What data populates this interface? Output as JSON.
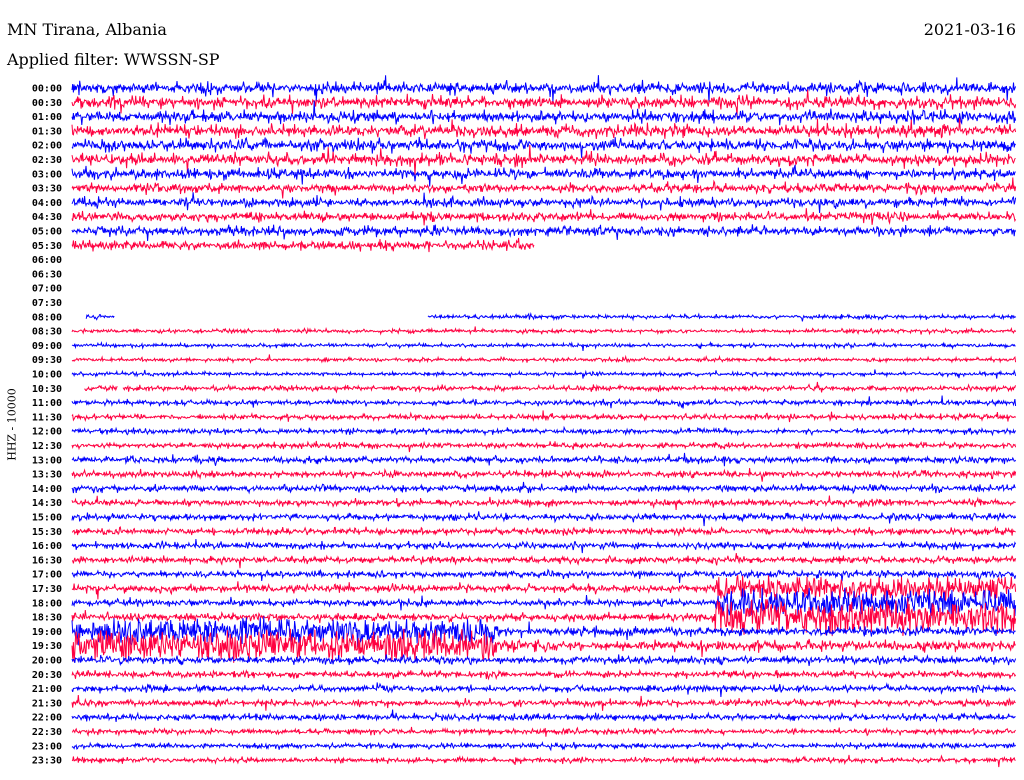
{
  "header": {
    "station": "MN Tirana, Albania",
    "date": "2021-03-16",
    "filter": "Applied filter: WWSSN-SP"
  },
  "chart_data": {
    "type": "line",
    "title": "MN Tirana, Albania",
    "ylabel": "HHZ - 10000",
    "colors": [
      "#0000ff",
      "#ff0040"
    ],
    "x_unit": "fraction of 30 min row",
    "rows": [
      {
        "label": "00:00",
        "segments": [
          [
            0,
            1
          ]
        ],
        "amp": 9
      },
      {
        "label": "00:30",
        "segments": [
          [
            0,
            1
          ]
        ],
        "amp": 9
      },
      {
        "label": "01:00",
        "segments": [
          [
            0,
            1
          ]
        ],
        "amp": 9
      },
      {
        "label": "01:30",
        "segments": [
          [
            0,
            1
          ]
        ],
        "amp": 9
      },
      {
        "label": "02:00",
        "segments": [
          [
            0,
            1
          ]
        ],
        "amp": 9
      },
      {
        "label": "02:30",
        "segments": [
          [
            0,
            1
          ]
        ],
        "amp": 9
      },
      {
        "label": "03:00",
        "segments": [
          [
            0,
            1
          ]
        ],
        "amp": 8
      },
      {
        "label": "03:30",
        "segments": [
          [
            0,
            1
          ]
        ],
        "amp": 7
      },
      {
        "label": "04:00",
        "segments": [
          [
            0,
            1
          ]
        ],
        "amp": 7
      },
      {
        "label": "04:30",
        "segments": [
          [
            0,
            1
          ]
        ],
        "amp": 7
      },
      {
        "label": "05:00",
        "segments": [
          [
            0,
            1
          ]
        ],
        "amp": 7
      },
      {
        "label": "05:30",
        "segments": [
          [
            0,
            0.49
          ]
        ],
        "amp": 7
      },
      {
        "label": "06:00",
        "segments": [],
        "amp": 0
      },
      {
        "label": "06:30",
        "segments": [],
        "amp": 0
      },
      {
        "label": "07:00",
        "segments": [],
        "amp": 0
      },
      {
        "label": "07:30",
        "segments": [],
        "amp": 0
      },
      {
        "label": "08:00",
        "segments": [
          [
            0.015,
            0.045
          ],
          [
            0.377,
            1
          ]
        ],
        "amp": 3
      },
      {
        "label": "08:30",
        "segments": [
          [
            0,
            1
          ]
        ],
        "amp": 3
      },
      {
        "label": "09:00",
        "segments": [
          [
            0,
            1
          ]
        ],
        "amp": 3
      },
      {
        "label": "09:30",
        "segments": [
          [
            0,
            1
          ]
        ],
        "amp": 3
      },
      {
        "label": "10:00",
        "segments": [
          [
            0,
            1
          ]
        ],
        "amp": 3
      },
      {
        "label": "10:30",
        "segments": [
          [
            0.013,
            0.048
          ],
          [
            0.054,
            1
          ]
        ],
        "amp": 4
      },
      {
        "label": "11:00",
        "segments": [
          [
            0,
            1
          ]
        ],
        "amp": 4
      },
      {
        "label": "11:30",
        "segments": [
          [
            0,
            1
          ]
        ],
        "amp": 4
      },
      {
        "label": "12:00",
        "segments": [
          [
            0,
            1
          ]
        ],
        "amp": 4
      },
      {
        "label": "12:30",
        "segments": [
          [
            0,
            1
          ]
        ],
        "amp": 4
      },
      {
        "label": "13:00",
        "segments": [
          [
            0,
            1
          ]
        ],
        "amp": 5
      },
      {
        "label": "13:30",
        "segments": [
          [
            0,
            1
          ]
        ],
        "amp": 5
      },
      {
        "label": "14:00",
        "segments": [
          [
            0,
            1
          ]
        ],
        "amp": 5
      },
      {
        "label": "14:30",
        "segments": [
          [
            0,
            1
          ]
        ],
        "amp": 5
      },
      {
        "label": "15:00",
        "segments": [
          [
            0,
            1
          ]
        ],
        "amp": 5
      },
      {
        "label": "15:30",
        "segments": [
          [
            0,
            1
          ]
        ],
        "amp": 5
      },
      {
        "label": "16:00",
        "segments": [
          [
            0,
            1
          ]
        ],
        "amp": 5
      },
      {
        "label": "16:30",
        "segments": [
          [
            0,
            1
          ]
        ],
        "amp": 5
      },
      {
        "label": "17:00",
        "segments": [
          [
            0,
            1
          ]
        ],
        "amp": 5
      },
      {
        "label": "17:30",
        "segments": [
          [
            0,
            1
          ]
        ],
        "amp": 6,
        "event": [
          0.68,
          1,
          14
        ]
      },
      {
        "label": "18:00",
        "segments": [
          [
            0,
            1
          ]
        ],
        "amp": 5,
        "event": [
          0.68,
          1,
          16
        ]
      },
      {
        "label": "18:30",
        "segments": [
          [
            0,
            1
          ]
        ],
        "amp": 6,
        "event": [
          0.68,
          1,
          20
        ]
      },
      {
        "label": "19:00",
        "segments": [
          [
            0,
            1
          ]
        ],
        "amp": 7,
        "event": [
          0,
          0.45,
          16
        ]
      },
      {
        "label": "19:30",
        "segments": [
          [
            0,
            1
          ]
        ],
        "amp": 8,
        "event": [
          0,
          0.45,
          18
        ]
      },
      {
        "label": "20:00",
        "segments": [
          [
            0,
            1
          ]
        ],
        "amp": 6
      },
      {
        "label": "20:30",
        "segments": [
          [
            0,
            1
          ]
        ],
        "amp": 5
      },
      {
        "label": "21:00",
        "segments": [
          [
            0,
            1
          ]
        ],
        "amp": 5
      },
      {
        "label": "21:30",
        "segments": [
          [
            0,
            1
          ]
        ],
        "amp": 5
      },
      {
        "label": "22:00",
        "segments": [
          [
            0,
            1
          ]
        ],
        "amp": 5
      },
      {
        "label": "22:30",
        "segments": [
          [
            0,
            1
          ]
        ],
        "amp": 4
      },
      {
        "label": "23:00",
        "segments": [
          [
            0,
            1
          ]
        ],
        "amp": 4
      },
      {
        "label": "23:30",
        "segments": [
          [
            0,
            1
          ]
        ],
        "amp": 4
      }
    ]
  }
}
